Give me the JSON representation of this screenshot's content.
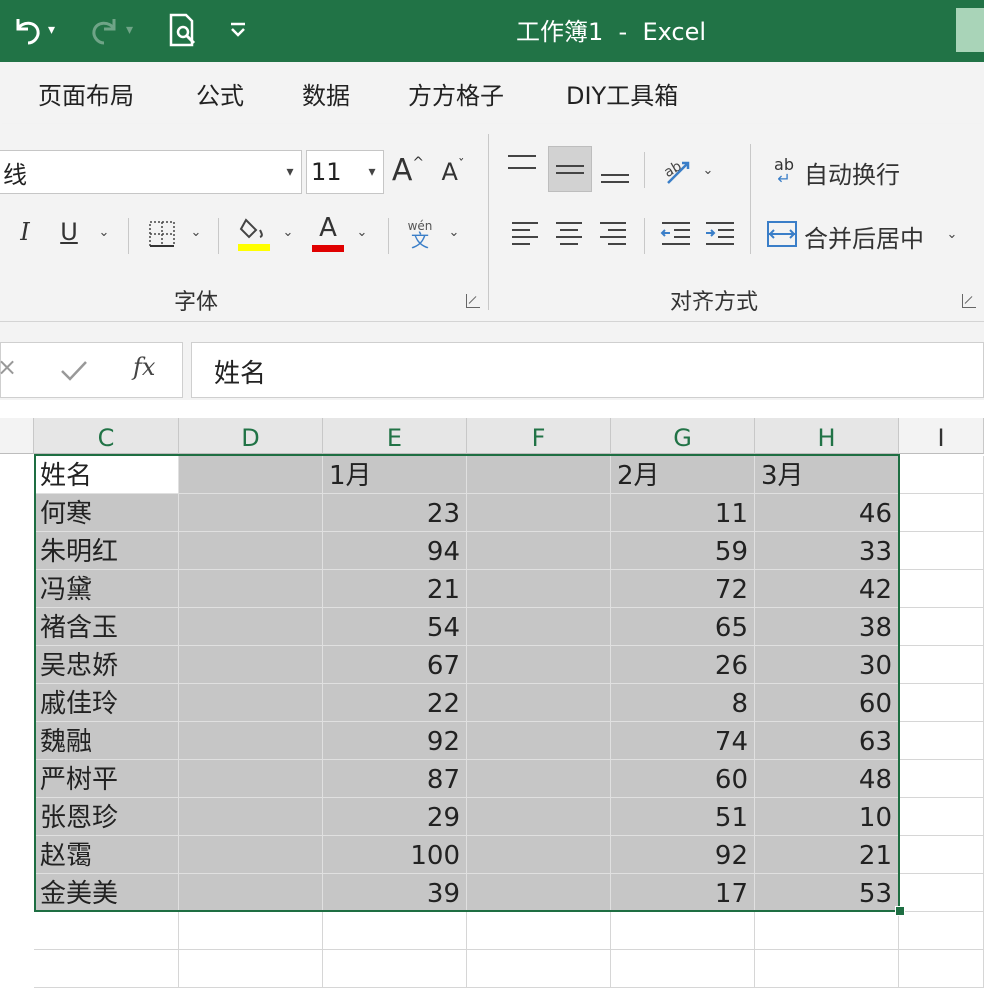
{
  "title_bar": {
    "title": "工作簿1  -  Excel",
    "bg": "#217346"
  },
  "qa": {
    "undo_icon": "undo-icon",
    "redo_icon": "redo-icon",
    "preview_icon": "print-preview-icon",
    "customize_icon": "customize-qat-icon"
  },
  "tabs": [
    "页面布局",
    "公式",
    "数据",
    "方方格子",
    "DIY工具箱"
  ],
  "ribbon": {
    "font_name": "线",
    "font_size": "11",
    "grow_label": "A",
    "shrink_label": "A",
    "italic": "I",
    "underline": "U",
    "font_color_glyph": "A",
    "fill_color": "#ffff00",
    "font_color": "#e00000",
    "phonetic_top": "wén",
    "phonetic_bottom": "文",
    "wrap_icon_text": "ab",
    "wrap_text": "自动换行",
    "merge_center": "合并后居中",
    "group_font": "字体",
    "group_align": "对齐方式"
  },
  "formula_bar": {
    "fx": "fx",
    "value": "姓名"
  },
  "columns": [
    "C",
    "D",
    "E",
    "F",
    "G",
    "H",
    "I"
  ],
  "table": {
    "header": [
      "姓名",
      "",
      "1月",
      "",
      "2月",
      "3月"
    ],
    "rows": [
      [
        "何寒",
        "",
        "23",
        "",
        "11",
        "46"
      ],
      [
        "朱明红",
        "",
        "94",
        "",
        "59",
        "33"
      ],
      [
        "冯黛",
        "",
        "21",
        "",
        "72",
        "42"
      ],
      [
        "褚含玉",
        "",
        "54",
        "",
        "65",
        "38"
      ],
      [
        "吴忠娇",
        "",
        "67",
        "",
        "26",
        "30"
      ],
      [
        "戚佳玲",
        "",
        "22",
        "",
        "8",
        "60"
      ],
      [
        "魏融",
        "",
        "92",
        "",
        "74",
        "63"
      ],
      [
        "严树平",
        "",
        "87",
        "",
        "60",
        "48"
      ],
      [
        "张恩珍",
        "",
        "29",
        "",
        "51",
        "10"
      ],
      [
        "赵霭",
        "",
        "100",
        "",
        "92",
        "21"
      ],
      [
        "金美美",
        "",
        "39",
        "",
        "17",
        "53"
      ]
    ]
  },
  "accent": "#217346",
  "selection_color": "#c6c6c6"
}
